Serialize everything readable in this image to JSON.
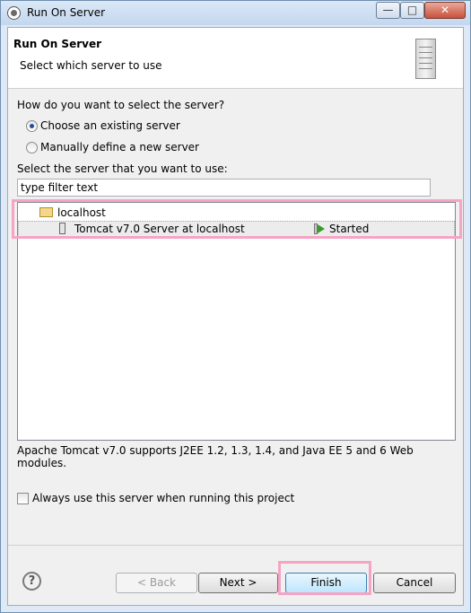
{
  "window": {
    "title": "Run On Server"
  },
  "banner": {
    "title": "Run On Server",
    "subtitle": "Select which server to use"
  },
  "question": "How do you want to select the server?",
  "radios": [
    {
      "label": "Choose an existing server",
      "checked": true
    },
    {
      "label": "Manually define a new server",
      "checked": false
    }
  ],
  "server_prompt": "Select the server that you want to use:",
  "filter": {
    "value": "type filter text"
  },
  "tree": {
    "host": {
      "label": "localhost",
      "icon": "folder-icon"
    },
    "server": {
      "name": "Tomcat v7.0 Server at localhost",
      "state": "Started",
      "icon": "server-icon",
      "state_icon": "started-icon"
    }
  },
  "description": "Apache Tomcat v7.0 supports J2EE 1.2, 1.3, 1.4, and Java EE 5 and 6 Web modules.",
  "always_use": {
    "label": "Always use this server when running this project",
    "checked": false
  },
  "buttons": {
    "back": "< Back",
    "next": "Next >",
    "finish": "Finish",
    "cancel": "Cancel"
  },
  "help_icon": "?",
  "title_controls": {
    "minimize": "—",
    "maximize": "□",
    "close": "✕"
  },
  "colors": {
    "highlight": "#f5a4c4",
    "radio_selected": "#1f4f96",
    "started_icon": "#3a9a2c"
  }
}
